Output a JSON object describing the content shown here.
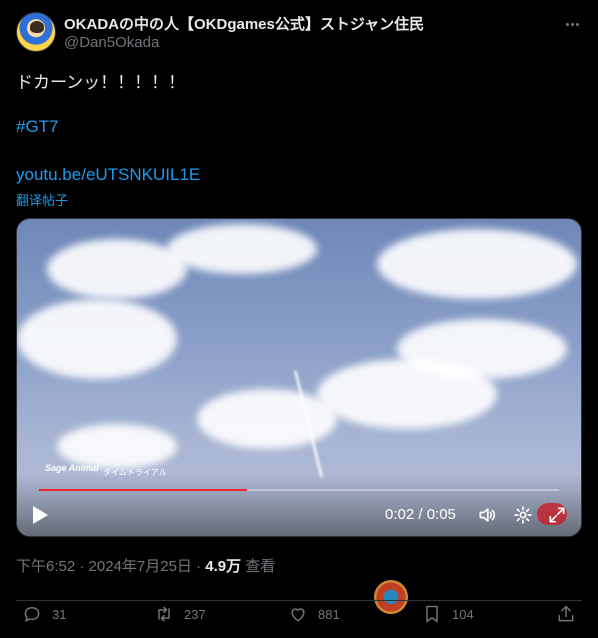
{
  "author": {
    "display_name": "OKADAの中の人【OKDgames公式】ストジャン住民",
    "handle": "@Dan5Okada"
  },
  "tweet": {
    "text": "ドカーンッ！！！！！",
    "hashtag": "#GT7",
    "link": "youtu.be/eUTSNKUIL1E",
    "translate_label": "翻译帖子"
  },
  "video": {
    "time_display": "0:02 / 0:05",
    "progress": 0.4,
    "overlay_logo": "Sage Animal",
    "overlay_label": "タイムトライアル"
  },
  "meta": {
    "time": "下午6:52 · 2024年7月25日 · ",
    "views_count": "4.9万",
    "views_label": " 查看"
  },
  "actions": {
    "replies": "31",
    "reposts": "237",
    "likes": "881",
    "bookmarks": "104"
  },
  "colors": {
    "accent": "#1d9bf0",
    "progress": "#f4212e",
    "muted": "#71767b",
    "text": "#e7e9ea"
  },
  "icons": [
    "more-icon",
    "play-icon",
    "volume-icon",
    "settings-icon",
    "fullscreen-icon",
    "reply-icon",
    "repost-icon",
    "like-icon",
    "bookmark-icon",
    "share-icon"
  ]
}
